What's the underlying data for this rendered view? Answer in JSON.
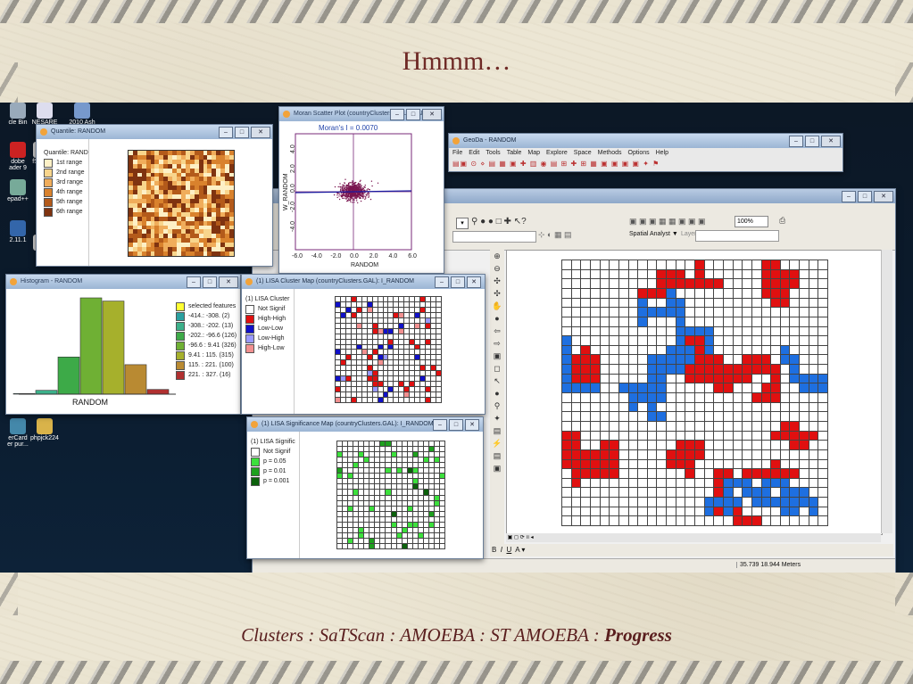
{
  "slide": {
    "title": "Hmmm…",
    "caption_parts": [
      "Clusters : SaTScan : AMOEBA : ST AMOEBA : ",
      "Progress"
    ]
  },
  "desktop": {
    "icons": [
      {
        "label": "cle Bin",
        "color": "#9ab"
      },
      {
        "label": "NESARE Bee",
        "color": "#dde"
      },
      {
        "label": "2010 Ash",
        "color": "#79c"
      },
      {
        "label": "dobe\nader 9",
        "color": "#c22"
      },
      {
        "label": "f5d8...",
        "color": "#ccc"
      },
      {
        "label": "epad++",
        "color": "#7a9"
      },
      {
        "label": "C\nAu",
        "color": "#aaa"
      },
      {
        "label": "2.11.1",
        "color": "#36a"
      },
      {
        "label": "EAI",
        "color": "#ccc"
      },
      {
        "label": "erCard\ner pur...",
        "color": "#48a"
      },
      {
        "label": "phpjck224",
        "color": "#d9b34a"
      }
    ]
  },
  "quantile": {
    "title": "Quantile: RANDOM",
    "legend_title": "Quantile: RAND",
    "items": [
      {
        "label": "1st range",
        "color": "#fdf0c6"
      },
      {
        "label": "2nd range",
        "color": "#f8d58c"
      },
      {
        "label": "3rd range",
        "color": "#f0ad5b"
      },
      {
        "label": "4th range",
        "color": "#d9822d"
      },
      {
        "label": "5th range",
        "color": "#b35a1a"
      },
      {
        "label": "6th range",
        "color": "#7f3310"
      }
    ]
  },
  "moran": {
    "title": "Moran Scatter Plot (countryClusters.GAL): RANDOM",
    "stat": "Moran's I = 0.0070",
    "xlabel": "RANDOM",
    "ylabel": "W_RANDOM",
    "xticks": [
      "-6.0",
      "-4.0",
      "-2.0",
      "0.0",
      "2.0",
      "4.0",
      "6.0"
    ],
    "yticks": [
      "4.0",
      "2.0",
      "0.0",
      "-2.0",
      "-4.0"
    ]
  },
  "histogram": {
    "title": "Histogram - RANDOM",
    "xlabel": "RANDOM",
    "legend": [
      {
        "label": "selected features",
        "color": "#ffff33"
      },
      {
        "label": "-414.: -308. (2)",
        "color": "#2aa0a0"
      },
      {
        "label": "-308.: -202. (13)",
        "color": "#3cb08a"
      },
      {
        "label": "-202.: -96.6 (126)",
        "color": "#3daa48"
      },
      {
        "label": "-96.6 : 9.41 (326)",
        "color": "#6fb034"
      },
      {
        "label": "9.41 : 115. (315)",
        "color": "#a6b02c"
      },
      {
        "label": "115. : 221. (100)",
        "color": "#b98a32"
      },
      {
        "label": "221. : 327. (16)",
        "color": "#b03030"
      }
    ],
    "counts": [
      2,
      13,
      126,
      326,
      315,
      100,
      16
    ]
  },
  "lisa_cluster": {
    "title": "(1) LISA Cluster Map (countryClusters.GAL): I_RANDOM",
    "legend_title": "(1) LISA Cluster",
    "items": [
      {
        "label": "Not Signif",
        "color": "#ffffff"
      },
      {
        "label": "High-High",
        "color": "#e01010"
      },
      {
        "label": "Low-Low",
        "color": "#1010c8"
      },
      {
        "label": "Low-High",
        "color": "#9999ff"
      },
      {
        "label": "High-Low",
        "color": "#f29090"
      }
    ]
  },
  "lisa_sig": {
    "title": "(1) LISA Significance Map (countryClusters.GAL): I_RANDOM",
    "legend_title": "(1) LISA Signific",
    "items": [
      {
        "label": "Not Signif",
        "color": "#ffffff"
      },
      {
        "label": "p = 0.05",
        "color": "#3ce03c"
      },
      {
        "label": "p = 0.01",
        "color": "#1ea01e"
      },
      {
        "label": "p = 0.001",
        "color": "#0b600b"
      }
    ]
  },
  "geoda": {
    "title": "GeoDa - RANDOM",
    "menus": [
      "File",
      "Edit",
      "Tools",
      "Table",
      "Map",
      "Explore",
      "Space",
      "Methods",
      "Options",
      "Help"
    ]
  },
  "arcmap": {
    "spatial_analyst": "Spatial Analyst ▼",
    "layer_label": "Layer",
    "zoom": "100%",
    "status": "35.739  18.944 Meters",
    "draw_tools": [
      "B",
      "I",
      "U",
      "A ▾"
    ]
  },
  "colors": {
    "cluster_red": "#e01010",
    "cluster_blue": "#1e6fe0"
  }
}
